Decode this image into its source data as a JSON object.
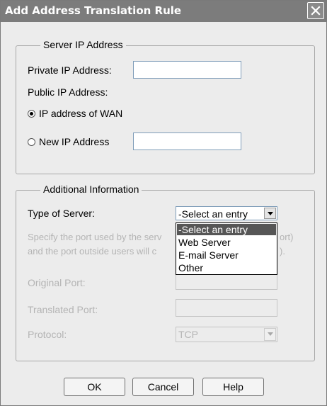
{
  "dialog": {
    "title": "Add Address Translation Rule"
  },
  "server_ip": {
    "legend": "Server IP Address",
    "private_label": "Private IP Address:",
    "private_value": "",
    "public_label": "Public IP Address:",
    "radio_wan_label": "IP address of WAN",
    "radio_wan_selected": true,
    "radio_new_label": "New IP Address",
    "radio_new_selected": false,
    "new_ip_value": ""
  },
  "additional": {
    "legend": "Additional Information",
    "type_label": "Type of Server:",
    "type_selected": "-Select an entry",
    "type_options": [
      "-Select an entry",
      "Web Server",
      "E-mail Server",
      "Other"
    ],
    "highlighted_option": "-Select an entry",
    "desc_line1_left": "Specify the port used by the serv",
    "desc_line1_right": "ort)",
    "desc_line2_left": "and the port outside users will c",
    "desc_line2_right": ").",
    "original_port_label": "Original Port:",
    "original_port_value": "",
    "translated_port_label": "Translated Port:",
    "translated_port_value": "",
    "protocol_label": "Protocol:",
    "protocol_value": "TCP"
  },
  "buttons": {
    "ok": "OK",
    "cancel": "Cancel",
    "help": "Help"
  },
  "icons": {
    "close": "close-icon",
    "dropdown": "chevron-down-icon"
  },
  "colors": {
    "titlebar": "#7c7c7c",
    "dialog_bg": "#ececec",
    "selection": "#565656",
    "disabled_text": "#b4b4b4"
  }
}
